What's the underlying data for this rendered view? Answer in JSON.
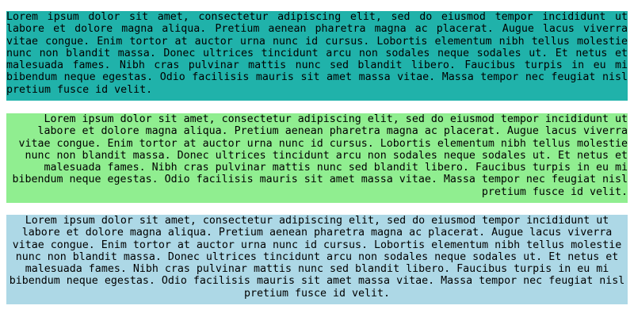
{
  "blocks": [
    {
      "text": "Lorem ipsum dolor sit amet, consectetur adipiscing elit, sed do eiusmod tempor incididunt ut labore et dolore magna aliqua. Pretium aenean pharetra magna ac placerat. Augue lacus viverra vitae congue. Enim tortor at auctor urna nunc id cursus. Lobortis elementum nibh tellus molestie nunc non blandit massa. Donec ultrices tincidunt arcu non sodales neque sodales ut. Et netus et malesuada fames. Nibh cras pulvinar mattis nunc sed blandit libero. Faucibus turpis in eu mi bibendum neque egestas. Odio facilisis mauris sit amet massa vitae. Massa tempor nec feugiat nisl pretium fusce id velit.",
      "color": "#20b2aa",
      "align": "justify"
    },
    {
      "text": "Lorem ipsum dolor sit amet, consectetur adipiscing elit, sed do eiusmod tempor incididunt ut labore et dolore magna aliqua. Pretium aenean pharetra magna ac placerat. Augue lacus viverra vitae congue. Enim tortor at auctor urna nunc id cursus. Lobortis elementum nibh tellus molestie nunc non blandit massa. Donec ultrices tincidunt arcu non sodales neque sodales ut. Et netus et malesuada fames. Nibh cras pulvinar mattis nunc sed blandit libero. Faucibus turpis in eu mi bibendum neque egestas. Odio facilisis mauris sit amet massa vitae. Massa tempor nec feugiat nisl pretium fusce id velit.",
      "color": "#90ee90",
      "align": "right"
    },
    {
      "text": "Lorem ipsum dolor sit amet, consectetur adipiscing elit, sed do eiusmod tempor incididunt ut labore et dolore magna aliqua. Pretium aenean pharetra magna ac placerat. Augue lacus viverra vitae congue. Enim tortor at auctor urna nunc id cursus. Lobortis elementum nibh tellus molestie nunc non blandit massa. Donec ultrices tincidunt arcu non sodales neque sodales ut. Et netus et malesuada fames. Nibh cras pulvinar mattis nunc sed blandit libero. Faucibus turpis in eu mi bibendum neque egestas. Odio facilisis mauris sit amet massa vitae. Massa tempor nec feugiat nisl pretium fusce id velit.",
      "color": "#add8e6",
      "align": "center"
    }
  ]
}
